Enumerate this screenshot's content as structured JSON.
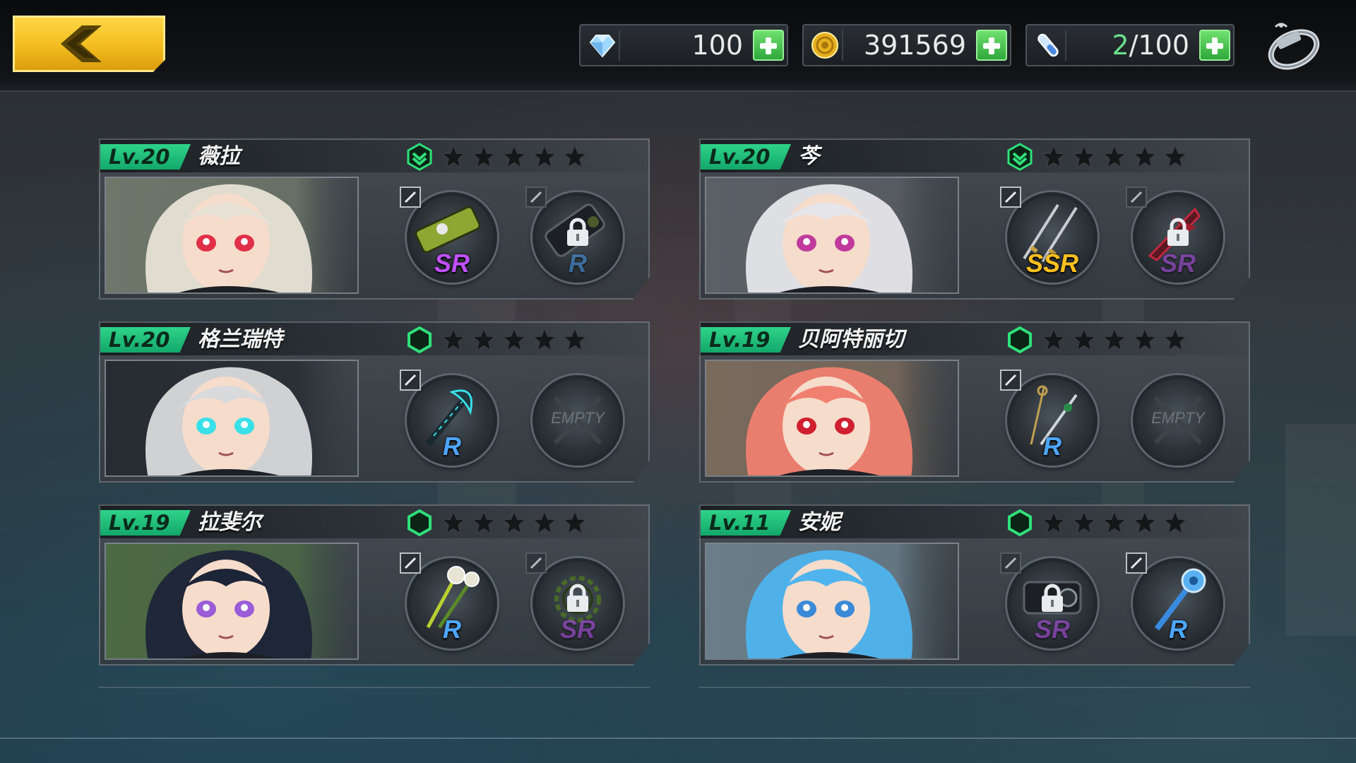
{
  "topbar": {
    "back_label": "",
    "resources": [
      {
        "name": "diamond",
        "icon": "diamond-icon",
        "value": "100"
      },
      {
        "name": "gold",
        "icon": "gold-coin-icon",
        "value": "391569"
      },
      {
        "name": "stamina",
        "icon": "stamina-vial-icon",
        "current": "2",
        "max": "/100"
      }
    ],
    "menu_icon": "ring-icon"
  },
  "characters": [
    {
      "level": "Lv.20",
      "name": "薇拉",
      "rank_shape": "chevron",
      "stars": 5,
      "slots": [
        {
          "state": "equipped",
          "rarity": "SR",
          "weapon": "death-cannon",
          "edit_active": true
        },
        {
          "state": "locked",
          "rarity": "R",
          "weapon": "heavy-cannon",
          "edit_active": false
        }
      ],
      "portrait": {
        "hair": "#e8e2d6",
        "eyes": "#e03048",
        "bg": "#6d776a"
      }
    },
    {
      "level": "Lv.20",
      "name": "芩",
      "rank_shape": "chevron",
      "stars": 5,
      "slots": [
        {
          "state": "equipped",
          "rarity": "SSR",
          "weapon": "twin-katana",
          "edit_active": true
        },
        {
          "state": "locked",
          "rarity": "SR",
          "weapon": "crimson-blade",
          "edit_active": false
        }
      ],
      "portrait": {
        "hair": "#e6e6ea",
        "eyes": "#c03a9c",
        "bg": "#5b5f66"
      }
    },
    {
      "level": "Lv.20",
      "name": "格兰瑞特",
      "rank_shape": "hexagon",
      "stars": 5,
      "slots": [
        {
          "state": "equipped",
          "rarity": "R",
          "weapon": "dark-glaive",
          "edit_active": true
        },
        {
          "state": "empty",
          "label": "EMPTY",
          "edit_active": false
        }
      ],
      "portrait": {
        "hair": "#d8dadc",
        "eyes": "#38e0e8",
        "bg": "#262c32"
      }
    },
    {
      "level": "Lv.19",
      "name": "贝阿特丽切",
      "rank_shape": "hexagon",
      "stars": 5,
      "slots": [
        {
          "state": "equipped",
          "rarity": "R",
          "weapon": "rapier-set",
          "edit_active": true
        },
        {
          "state": "empty",
          "label": "EMPTY",
          "edit_active": false
        }
      ],
      "portrait": {
        "hair": "#f08070",
        "eyes": "#d02030",
        "bg": "#7a6a5c"
      }
    },
    {
      "level": "Lv.19",
      "name": "拉斐尔",
      "rank_shape": "hexagon",
      "stars": 5,
      "slots": [
        {
          "state": "equipped",
          "rarity": "R",
          "weapon": "flower-staff",
          "edit_active": true
        },
        {
          "state": "locked",
          "rarity": "SR",
          "weapon": "chain-whip",
          "edit_active": false
        }
      ],
      "portrait": {
        "hair": "#1c2438",
        "eyes": "#9a5cd8",
        "bg": "#4c6a44"
      }
    },
    {
      "level": "Lv.11",
      "name": "安妮",
      "rank_shape": "hexagon",
      "stars": 5,
      "slots": [
        {
          "state": "locked",
          "rarity": "SR",
          "weapon": "camera-gun",
          "edit_active": false
        },
        {
          "state": "equipped",
          "rarity": "R",
          "weapon": "gear-wand",
          "edit_active": true
        }
      ],
      "portrait": {
        "hair": "#4fb4ee",
        "eyes": "#3a8ad8",
        "bg": "#6a7e8a"
      }
    }
  ],
  "colors": {
    "accent_green": "#2fd38a",
    "back_button": "#f2bc1e",
    "rarity_R": "#4da6ff",
    "rarity_SR": "#c050ff",
    "rarity_SSR": "#ffc020"
  }
}
